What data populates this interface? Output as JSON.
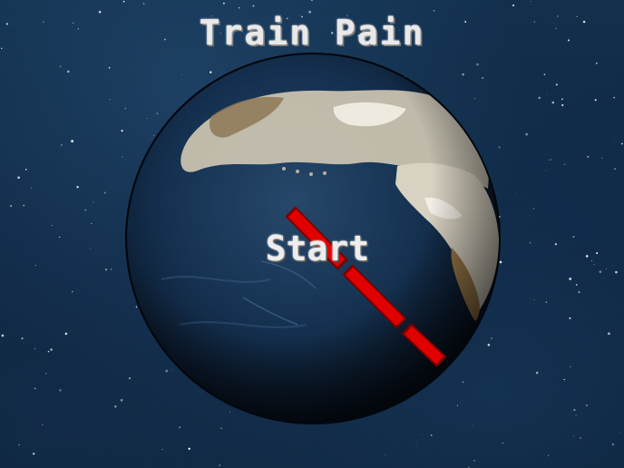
{
  "game": {
    "title": "Train Pain",
    "start_label": "Start"
  },
  "icons": {
    "globe": "earth-globe-icon",
    "train": "train-icon"
  },
  "colors": {
    "train": "#e10000",
    "train_dark": "#7a0000",
    "title_text": "#e9e9e9",
    "background": "#0d2540"
  }
}
